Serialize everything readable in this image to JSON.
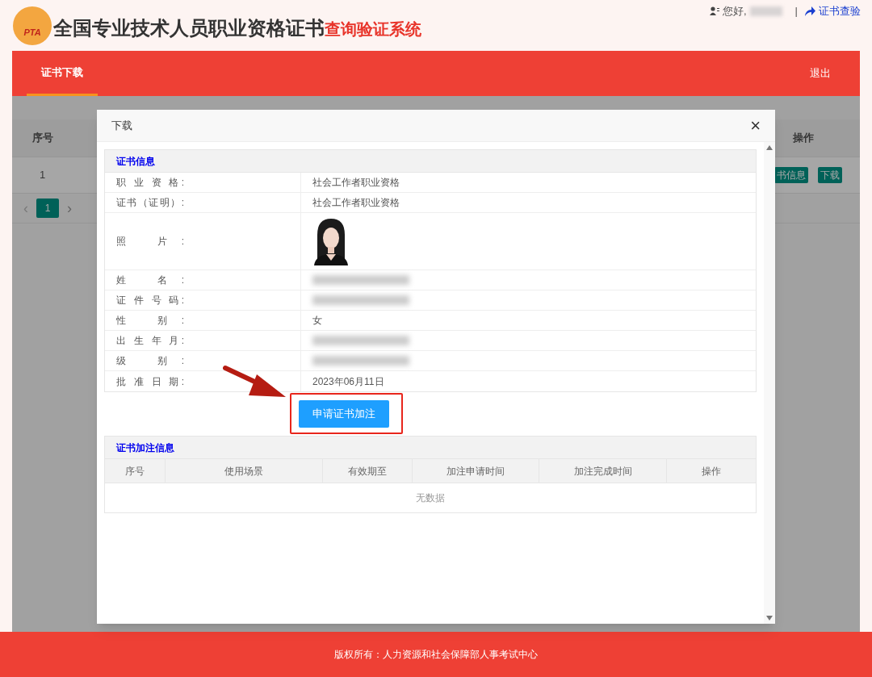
{
  "header": {
    "logo_text": "PTA",
    "title": "全国专业技术人员职业资格证书",
    "title_suffix": "查询验证系统",
    "greeting": "您好,",
    "name_redacted": true,
    "separator": "|",
    "verify_link": "证书查验"
  },
  "nav": {
    "tabs": [
      {
        "label": "证书下载",
        "selected": true
      }
    ],
    "logout": "退出"
  },
  "background_table": {
    "columns": [
      "序号",
      "操作"
    ],
    "rows": [
      {
        "index": "1",
        "actions": [
          "书信息",
          "下载"
        ]
      }
    ],
    "pagination": {
      "prev": "‹",
      "pages": [
        {
          "label": "1",
          "selected": true
        }
      ],
      "next": "›"
    }
  },
  "dialog": {
    "title": "下载",
    "close": "×",
    "info_section": {
      "title": "证书信息",
      "rows": [
        {
          "label": "职 业 资 格:",
          "kind": "text",
          "value": "社会工作者职业资格"
        },
        {
          "label": "证书（证明）:",
          "kind": "text",
          "value": "社会工作者职业资格"
        },
        {
          "label": "照 片:"
        },
        {
          "label": "姓 名:",
          "kind": "redacted"
        },
        {
          "label": "证 件 号 码:",
          "kind": "redacted"
        },
        {
          "label": "性 别:",
          "kind": "text",
          "value": "女"
        },
        {
          "label": "出 生 年 月:",
          "kind": "redacted"
        },
        {
          "label": "级 别:",
          "kind": "redacted"
        },
        {
          "label": "批 准 日 期:",
          "kind": "text",
          "value": "2023年06月11日"
        }
      ]
    },
    "apply_button": "申请证书加注",
    "highlighted": true,
    "annotation_section": {
      "title": "证书加注信息",
      "columns": [
        "序号",
        "使用场景",
        "有效期至",
        "加注申请时间",
        "加注完成时间",
        "操作"
      ],
      "empty_text": "无数据"
    }
  },
  "footer": "版权所有：人力资源和社会保障部人事考试中心"
}
